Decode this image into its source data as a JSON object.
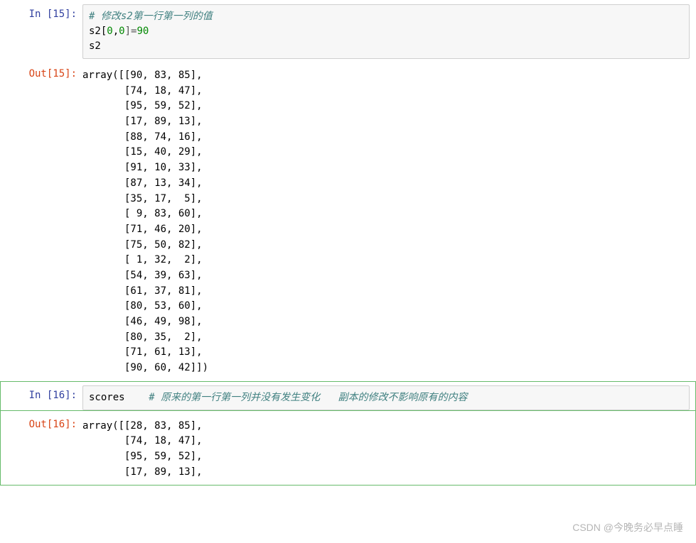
{
  "cells": [
    {
      "in_prompt": "In  [15]:",
      "out_prompt": "Out[15]:",
      "code": {
        "comment": "# 修改s2第一行第一列的值",
        "line2_pre": "s2[",
        "line2_idx1": "0",
        "line2_sep": ",",
        "line2_idx2": "0",
        "line2_assign": "]=",
        "line2_val": "90",
        "line3": "s2"
      },
      "output": "array([[90, 83, 85],\n       [74, 18, 47],\n       [95, 59, 52],\n       [17, 89, 13],\n       [88, 74, 16],\n       [15, 40, 29],\n       [91, 10, 33],\n       [87, 13, 34],\n       [35, 17,  5],\n       [ 9, 83, 60],\n       [71, 46, 20],\n       [75, 50, 82],\n       [ 1, 32,  2],\n       [54, 39, 63],\n       [61, 37, 81],\n       [80, 53, 60],\n       [46, 49, 98],\n       [80, 35,  2],\n       [71, 61, 13],\n       [90, 60, 42]])"
    },
    {
      "in_prompt": "In  [16]:",
      "out_prompt": "Out[16]:",
      "code": {
        "line1_var": "scores    ",
        "line1_comment": "# 原来的第一行第一列并没有发生变化   副本的修改不影响原有的内容"
      },
      "output": "array([[28, 83, 85],\n       [74, 18, 47],\n       [95, 59, 52],\n       [17, 89, 13],"
    }
  ],
  "watermark": "CSDN @今晚务必早点睡"
}
